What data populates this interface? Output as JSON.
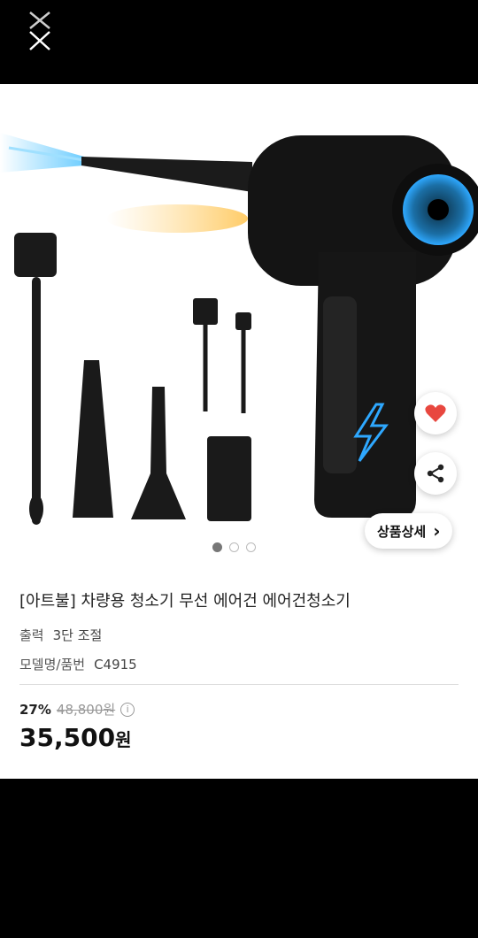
{
  "product": {
    "title": "[아트불] 차량용 청소기 무선 에어건 에어건청소기",
    "specs": [
      {
        "label": "출력",
        "value": "3단 조절"
      },
      {
        "label": "모델명/품번",
        "value": "C4915"
      }
    ],
    "discount_rate": "27%",
    "original_price": "48,800원",
    "sale_price": "35,500",
    "currency": "원"
  },
  "actions": {
    "detail_label": "상품상세",
    "detail_chevron": "›"
  },
  "icons": {
    "close": "close-icon",
    "like": "heart-icon",
    "share": "share-icon",
    "info": "info-icon"
  },
  "image_dots": {
    "count": 3,
    "active": 0
  },
  "colors": {
    "heart": "#e8473f",
    "accent_blue": "#2ea8ff",
    "dark": "#111111"
  }
}
